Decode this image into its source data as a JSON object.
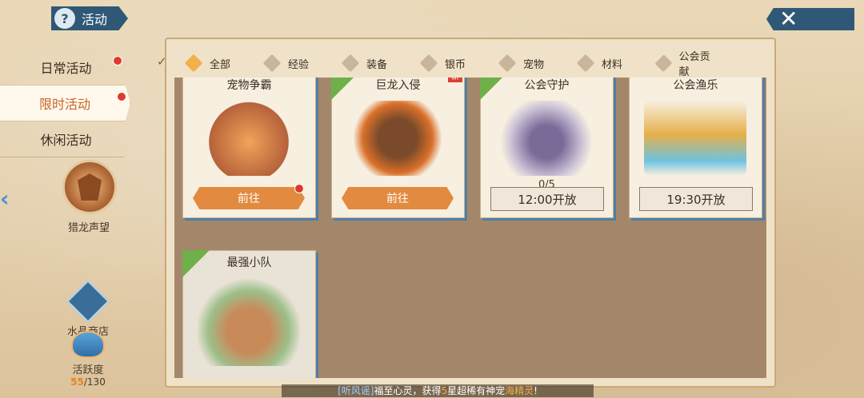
{
  "header": {
    "title": "活动",
    "help_icon": "question-icon"
  },
  "close": {
    "icon": "close-icon"
  },
  "nav": {
    "items": [
      {
        "label": "日常活动",
        "dot": true
      },
      {
        "label": "限时活动",
        "dot": true,
        "active": true
      },
      {
        "label": "休闲活动",
        "dot": false
      }
    ]
  },
  "reputation": {
    "label": "猎龙声望"
  },
  "shop": {
    "label": "水晶商店"
  },
  "activity": {
    "label": "活跃度",
    "current": "55",
    "total": "/130"
  },
  "filters": [
    {
      "label": "全部",
      "selected": true
    },
    {
      "label": "经验"
    },
    {
      "label": "装备"
    },
    {
      "label": "银币"
    },
    {
      "label": "宠物"
    },
    {
      "label": "材料"
    },
    {
      "label": "公会贡献"
    }
  ],
  "cards": [
    {
      "title": "宠物争霸",
      "button": "前往",
      "dot": true,
      "corner": false
    },
    {
      "title": "巨龙入侵",
      "button": "前往",
      "new": "新",
      "corner": true
    },
    {
      "title": "公会守护",
      "progress": "0/5",
      "button": "12:00开放",
      "corner": true
    },
    {
      "title": "公会渔乐",
      "button": "19:30开放",
      "corner": true
    },
    {
      "title": "最强小队",
      "corner": true
    }
  ],
  "ticker": {
    "channel": "[听风谣]",
    "text1": "福至心灵，获得",
    "num": "5",
    "text2": "星超稀有神宠",
    "pet": "海精灵",
    "end": "!"
  }
}
